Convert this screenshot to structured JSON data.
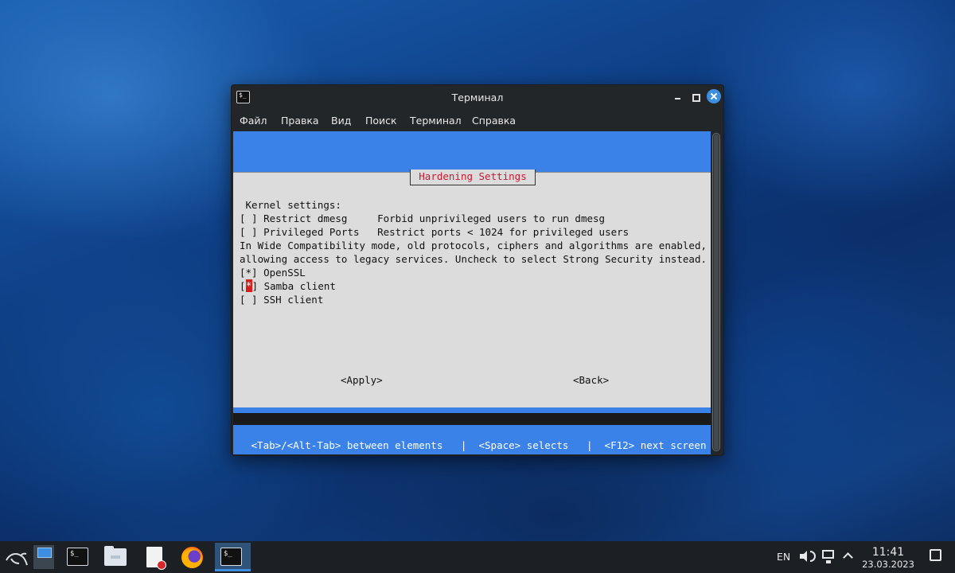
{
  "window": {
    "title": "Терминал",
    "app_icon_glyph": "$_"
  },
  "menubar": {
    "items": [
      "Файл",
      "Правка",
      "Вид",
      "Поиск",
      "Терминал",
      "Справка"
    ]
  },
  "dialog": {
    "title": "Hardening Settings",
    "lines": {
      "kernel_header": " Kernel settings:",
      "restrict_dmesg": "[ ] Restrict dmesg     Forbid unprivileged users to run dmesg",
      "privileged_ports": "[ ] Privileged Ports   Restrict ports < 1024 for privileged users",
      "wide_compat_1": "In Wide Compatibility mode, old protocols, ciphers and algorithms are enabled,",
      "wide_compat_2": "allowing access to legacy services. Uncheck to select Strong Security instead.",
      "openssl": "[*] OpenSSL",
      "samba_prefix": "[",
      "samba_mark": "*",
      "samba_suffix": "] Samba client",
      "ssh": "[ ] SSH client"
    },
    "checkboxes": [
      {
        "label": "Restrict dmesg",
        "checked": false
      },
      {
        "label": "Privileged Ports",
        "checked": false
      },
      {
        "label": "OpenSSL",
        "checked": true
      },
      {
        "label": "Samba client",
        "checked": true,
        "focused": true
      },
      {
        "label": "SSH client",
        "checked": false
      }
    ],
    "apply_label": "<Apply>",
    "back_label": "<Back>"
  },
  "statusline": " <Tab>/<Alt-Tab> between elements   |  <Space> selects   |  <F12> next screen",
  "taskbar": {
    "app_menu_icon": "kali-dragon-icon",
    "terminal_glyph": "$_",
    "language": "EN",
    "time": "11:41",
    "date": "23.03.2023"
  },
  "colors": {
    "terminal_blue": "#3a82e8",
    "dialog_gray": "#dcdcdc",
    "dialog_title_red": "#c9192f",
    "accent": "#3d8ee0"
  }
}
